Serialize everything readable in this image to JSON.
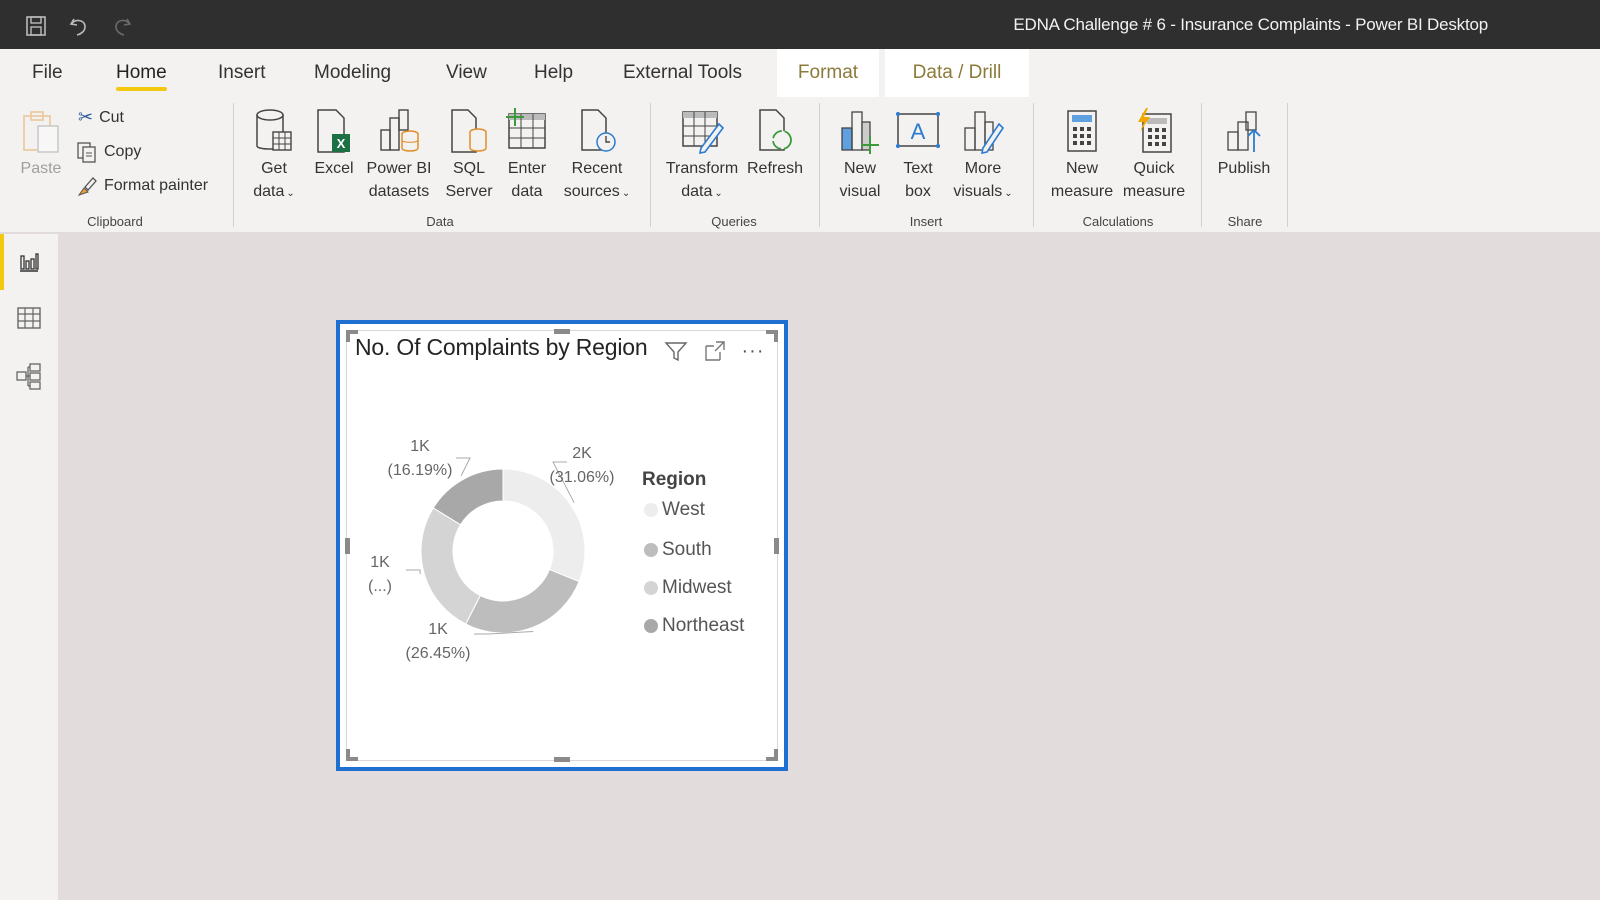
{
  "window": {
    "title": "EDNA Challenge # 6 - Insurance Complaints - Power BI Desktop",
    "quick_access": [
      "save-icon",
      "undo-icon",
      "redo-icon"
    ]
  },
  "tabs": [
    {
      "label": "File"
    },
    {
      "label": "Home",
      "active": true
    },
    {
      "label": "Insert"
    },
    {
      "label": "Modeling"
    },
    {
      "label": "View"
    },
    {
      "label": "Help"
    },
    {
      "label": "External Tools"
    },
    {
      "label": "Format",
      "contextual": true
    },
    {
      "label": "Data / Drill",
      "contextual": true
    }
  ],
  "ribbon": {
    "clipboard": {
      "label": "Clipboard",
      "paste": "Paste",
      "cut": "Cut",
      "copy": "Copy",
      "format_painter": "Format painter"
    },
    "data": {
      "label": "Data",
      "get_data": [
        "Get",
        "data"
      ],
      "excel": "Excel",
      "powerbi_datasets": [
        "Power BI",
        "datasets"
      ],
      "sql_server": [
        "SQL",
        "Server"
      ],
      "enter_data": [
        "Enter",
        "data"
      ],
      "recent_sources": [
        "Recent",
        "sources"
      ]
    },
    "queries": {
      "label": "Queries",
      "transform_data": [
        "Transform",
        "data"
      ],
      "refresh": "Refresh"
    },
    "insert": {
      "label": "Insert",
      "new_visual": [
        "New",
        "visual"
      ],
      "text_box": [
        "Text",
        "box"
      ],
      "more_visuals": [
        "More",
        "visuals"
      ]
    },
    "calculations": {
      "label": "Calculations",
      "new_measure": [
        "New",
        "measure"
      ],
      "quick_measure": [
        "Quick",
        "measure"
      ]
    },
    "share": {
      "label": "Share",
      "publish": "Publish"
    }
  },
  "leftnav": [
    {
      "name": "report-view",
      "icon": "bar-chart-icon",
      "active": true
    },
    {
      "name": "data-view",
      "icon": "table-icon"
    },
    {
      "name": "model-view",
      "icon": "model-icon"
    }
  ],
  "visual": {
    "title": "No. Of Complaints by Region",
    "header_icons": [
      "filter-icon",
      "focus-mode-icon",
      "more-options-icon"
    ]
  },
  "chart_data": {
    "type": "pie",
    "variant": "donut",
    "title": "No. Of Complaints by Region",
    "legend_title": "Region",
    "legend_position": "right",
    "categories": [
      "West",
      "South",
      "Midwest",
      "Northeast"
    ],
    "values_percent": [
      31.06,
      26.45,
      26.3,
      16.19
    ],
    "value_labels": [
      "2K",
      "1K",
      "1K",
      "1K"
    ],
    "percent_labels": [
      "(31.06%)",
      "(26.45%)",
      "(...)",
      "(16.19%)"
    ],
    "colors": [
      "#ededed",
      "#bdbdbd",
      "#d4d4d4",
      "#a8a8a8"
    ]
  }
}
